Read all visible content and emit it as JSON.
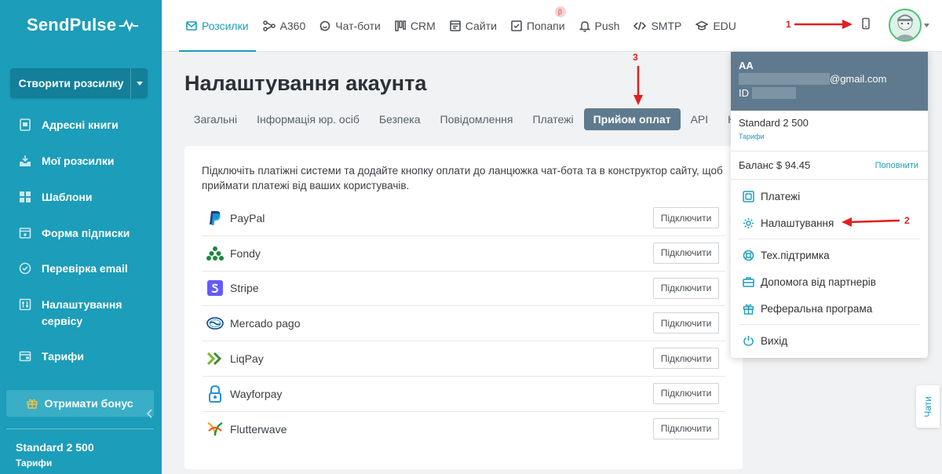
{
  "sidebar": {
    "logo": "SendPulse",
    "create_button": "Створити розсилку",
    "items": [
      {
        "label": "Адресні книги",
        "icon": "address-book-icon"
      },
      {
        "label": "Мої розсилки",
        "icon": "campaigns-icon"
      },
      {
        "label": "Шаблони",
        "icon": "templates-icon"
      },
      {
        "label": "Форма підписки",
        "icon": "subscription-form-icon"
      },
      {
        "label": "Перевірка email",
        "icon": "email-check-icon"
      },
      {
        "label": "Налаштування сервісу",
        "icon": "service-settings-icon"
      },
      {
        "label": "Тарифи",
        "icon": "pricing-icon"
      }
    ],
    "bonus_button": "Отримати бонус",
    "plan_name": "Standard 2 500",
    "plan_link": "Тарифи"
  },
  "topnav": {
    "items": [
      {
        "label": "Розсилки",
        "icon": "email-icon",
        "active": true
      },
      {
        "label": "A360",
        "icon": "automation-icon"
      },
      {
        "label": "Чат-боти",
        "icon": "chatbot-icon"
      },
      {
        "label": "CRM",
        "icon": "crm-icon"
      },
      {
        "label": "Сайти",
        "icon": "sites-icon"
      },
      {
        "label": "Попапи",
        "icon": "popups-icon",
        "badge": "β"
      },
      {
        "label": "Push",
        "icon": "bell-icon"
      },
      {
        "label": "SMTP",
        "icon": "code-icon"
      },
      {
        "label": "EDU",
        "icon": "graduation-cap-icon"
      }
    ]
  },
  "page": {
    "title": "Налаштування акаунта",
    "tabs": [
      "Загальні",
      "Інформація юр. осіб",
      "Безпека",
      "Повідомлення",
      "Платежі",
      "Прийом оплат",
      "API",
      "К"
    ],
    "active_tab": "Прийом оплат",
    "description": "Підключіть платіжні системи та додайте кнопку оплати до ланцюжка чат-бота та в конструктор сайту, щоб приймати платежі від ваших користувачів.",
    "connect_label": "Підключити",
    "providers": [
      {
        "name": "PayPal",
        "icon": "paypal-icon"
      },
      {
        "name": "Fondy",
        "icon": "fondy-icon"
      },
      {
        "name": "Stripe",
        "icon": "stripe-icon"
      },
      {
        "name": "Mercado pago",
        "icon": "mercado-pago-icon"
      },
      {
        "name": "LiqPay",
        "icon": "liqpay-icon"
      },
      {
        "name": "Wayforpay",
        "icon": "wayforpay-icon"
      },
      {
        "name": "Flutterwave",
        "icon": "flutterwave-icon"
      }
    ]
  },
  "account_menu": {
    "name": "AA",
    "email_suffix": "@gmail.com",
    "id_label": "ID",
    "plan": "Standard 2 500",
    "plan_link": "Тарифи",
    "balance": "Баланс $ 94.45",
    "topup": "Поповнити",
    "items": [
      {
        "label": "Платежі",
        "icon": "payments-icon"
      },
      {
        "label": "Налаштування",
        "icon": "gear-icon"
      },
      {
        "label": "Тех.підтримка",
        "icon": "support-icon"
      },
      {
        "label": "Допомога від партнерів",
        "icon": "partners-icon"
      },
      {
        "label": "Реферальна програма",
        "icon": "gift-icon"
      },
      {
        "label": "Вихід",
        "icon": "power-icon"
      }
    ]
  },
  "annotations": {
    "one": "1",
    "two": "2",
    "three": "3"
  },
  "chat_tab": "Чати",
  "colors": {
    "sidebar": "#1c9db9",
    "accent": "#1c9db9",
    "active_tab": "#5f7a8e",
    "annotation": "#e02020"
  }
}
